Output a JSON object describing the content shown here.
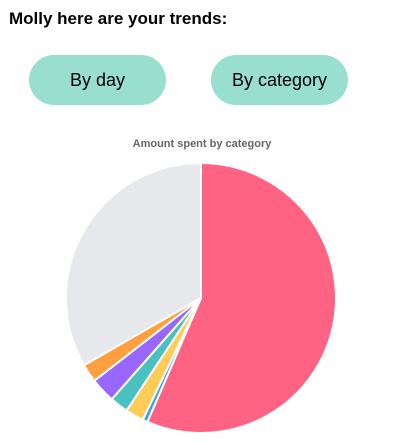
{
  "header": {
    "title": "Molly here are your trends:"
  },
  "buttons": {
    "by_day": "By day",
    "by_category": "By category"
  },
  "chart_data": {
    "type": "pie",
    "title": "Amount spent by category",
    "values": [
      56.5,
      0.6,
      2.2,
      2.2,
      3.0,
      2.2,
      33.3
    ],
    "colors": [
      "#ff6384",
      "#36a2eb",
      "#ffcd56",
      "#4bc0c0",
      "#9966ff",
      "#ff9f40",
      "#e7e8ec"
    ],
    "legend": "none"
  }
}
